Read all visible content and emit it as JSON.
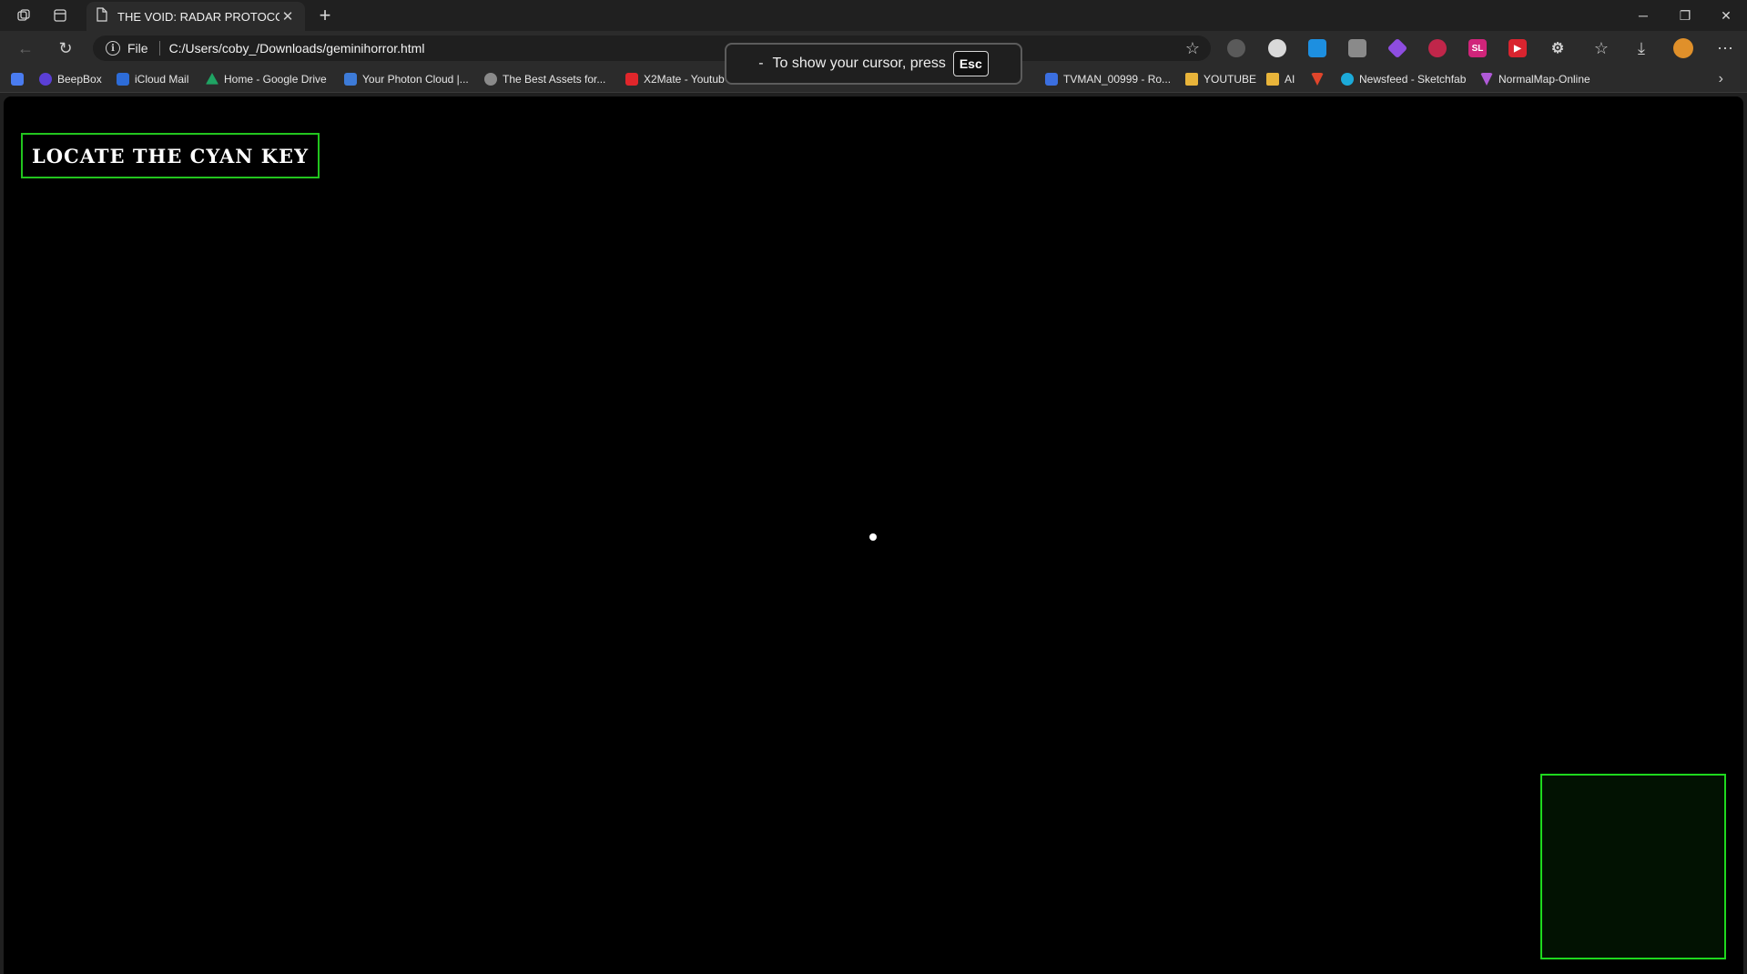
{
  "browser": {
    "tab": {
      "title": "THE VOID: RADAR PROTOCOL",
      "close_glyph": "✕"
    },
    "new_tab_glyph": "+",
    "window_controls": {
      "minimize": "─",
      "restore": "❐",
      "close": "✕"
    },
    "address": {
      "scheme_label": "File",
      "url": "C:/Users/coby_/Downloads/geminihorror.html"
    },
    "toolbar_glyphs": {
      "star": "☆",
      "favorites": "☆",
      "downloads": "⤓",
      "menu": "⋯",
      "back": "←",
      "reload": "↻"
    }
  },
  "bookmarks": [
    {
      "label": "",
      "icon": "docs-icon",
      "color": "#4a7cf0"
    },
    {
      "label": "BeepBox",
      "icon": "beepbox-icon",
      "color": "#5b3fd6"
    },
    {
      "label": "iCloud Mail",
      "icon": "icloud-mail-icon",
      "color": "#2d6cd8"
    },
    {
      "label": "Home - Google Drive",
      "icon": "google-drive-icon",
      "color": "#1fa463"
    },
    {
      "label": "Your Photon Cloud |...",
      "icon": "photon-icon",
      "color": "#3d7bd8"
    },
    {
      "label": "The Best Assets for...",
      "icon": "unity-icon",
      "color": "#8a8a8a"
    },
    {
      "label": "X2Mate - Youtub",
      "icon": "x2mate-icon",
      "color": "#e0262b"
    },
    {
      "label": "TVMAN_00999 - Ro...",
      "icon": "roblox-icon",
      "color": "#3b6fe0"
    },
    {
      "label": "YOUTUBE",
      "icon": "folder-icon",
      "color": "#e8b43a"
    },
    {
      "label": "AI",
      "icon": "folder-icon",
      "color": "#e8b43a"
    },
    {
      "label": "",
      "icon": "x-brand-icon",
      "color": "#e0452b"
    },
    {
      "label": "Newsfeed - Sketchfab",
      "icon": "sketchfab-icon",
      "color": "#1caad9"
    },
    {
      "label": "NormalMap-Online",
      "icon": "normalmap-icon",
      "color": "#b05ad8"
    }
  ],
  "bookmarks_more_glyph": "›",
  "toast": {
    "dash": "-",
    "text": "To show your cursor, press",
    "key": "Esc"
  },
  "game": {
    "objective": "LOCATE THE CYAN KEY"
  },
  "colors": {
    "hud_green": "#22c51e",
    "radar_fill": "#021202",
    "page_bg": "#000000"
  }
}
